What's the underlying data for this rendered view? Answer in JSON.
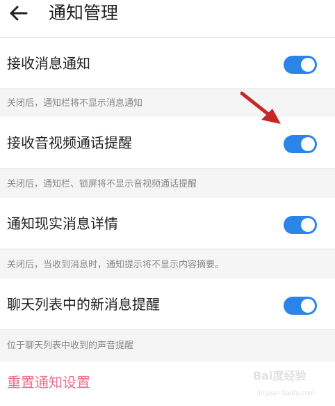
{
  "header": {
    "title": "通知管理"
  },
  "settings": [
    {
      "label": "接收消息通知",
      "enabled": true,
      "description": "关闭后，通知栏将不显示消息通知"
    },
    {
      "label": "接收音视频通话提醒",
      "enabled": true,
      "description": "关闭后，通知栏、锁屏将不显示音视频通话提醒"
    },
    {
      "label": "通知现实消息详情",
      "enabled": true,
      "description": "关闭后，当收到消息时，通知提示将不显示内容摘要。"
    },
    {
      "label": "聊天列表中的新消息提醒",
      "enabled": true,
      "description": "位于聊天列表中收到的声音提醒"
    }
  ],
  "reset": {
    "label": "重置通知设置"
  },
  "watermark": {
    "text": "Bai度经验",
    "url": "jingyan.baidu.com"
  },
  "colors": {
    "toggle_on": "#2b84e8",
    "reset_text": "#e8728a",
    "arrow": "#c62828"
  }
}
